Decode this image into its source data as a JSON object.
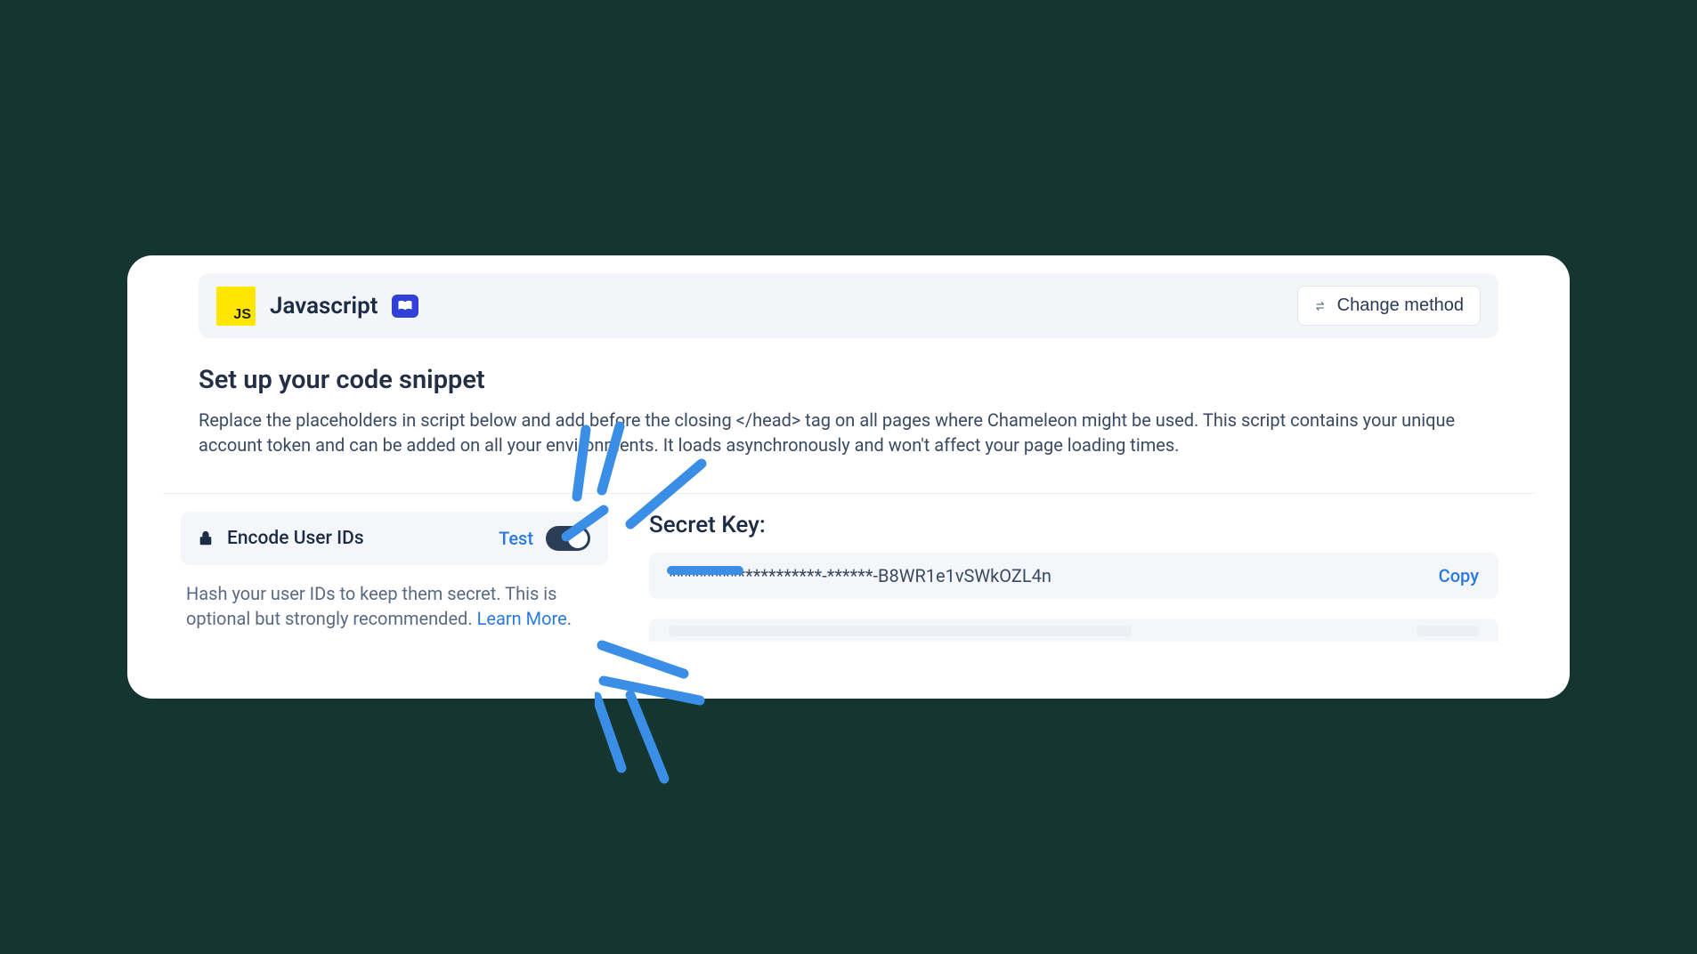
{
  "method": {
    "icon_text": "JS",
    "title": "Javascript",
    "change_label": "Change method"
  },
  "section": {
    "title": "Set up your code snippet",
    "description": "Replace the placeholders in script below and add before the closing </head> tag on all pages where Chameleon might be used. This script contains your unique account token and can be added on all your environments. It loads asynchronously and won't affect your page loading times."
  },
  "encode": {
    "label": "Encode User IDs",
    "test_label": "Test",
    "toggle_on": true,
    "description_part1": "Hash your user IDs to keep them secret. This is optional but strongly recommended. ",
    "learn_label": "Learn More",
    "description_suffix": "."
  },
  "secret": {
    "heading": "Secret Key:",
    "value": "********************-******-B8WR1e1vSWkOZL4n",
    "copy_label": "Copy"
  },
  "colors": {
    "background": "#153630",
    "accent_blue": "#2a7ae2",
    "annotation": "#3a8ee6",
    "js_yellow": "#ffe600",
    "book_badge": "#2f3fd7"
  }
}
